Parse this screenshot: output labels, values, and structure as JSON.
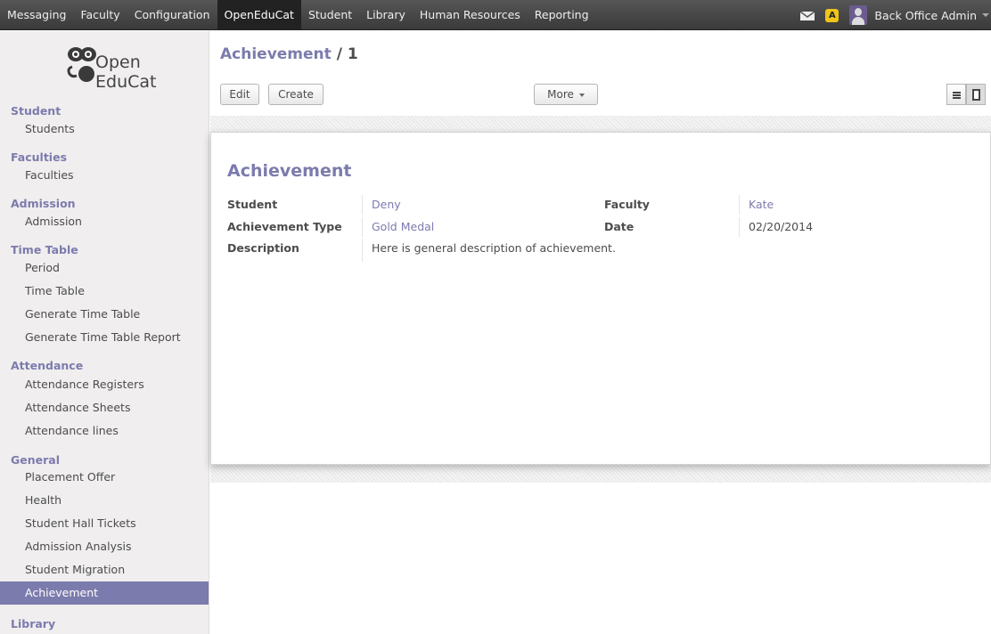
{
  "topbar": {
    "menu": [
      "Messaging",
      "Faculty",
      "Configuration",
      "OpenEduCat",
      "Student",
      "Library",
      "Human Resources",
      "Reporting"
    ],
    "active_menu": "OpenEduCat",
    "user_name": "Back Office Admin",
    "warning_label": "A",
    "colors": {
      "bar": "#3a3a3a",
      "active": "#222222"
    }
  },
  "sidebar": {
    "logo": {
      "line1": "Open",
      "line2": "EduCat"
    },
    "sections": [
      {
        "title": "Student",
        "items": [
          "Students"
        ]
      },
      {
        "title": "Faculties",
        "items": [
          "Faculties"
        ]
      },
      {
        "title": "Admission",
        "items": [
          "Admission"
        ]
      },
      {
        "title": "Time Table",
        "items": [
          "Period",
          "Time Table",
          "Generate Time Table",
          "Generate Time Table Report"
        ]
      },
      {
        "title": "Attendance",
        "items": [
          "Attendance Registers",
          "Attendance Sheets",
          "Attendance lines"
        ]
      },
      {
        "title": "General",
        "items": [
          "Placement Offer",
          "Health",
          "Student Hall Tickets",
          "Admission Analysis",
          "Student Migration",
          "Achievement"
        ]
      },
      {
        "title": "Library",
        "items": []
      }
    ],
    "active_item": "Achievement",
    "accent_color": "#7c7bad"
  },
  "breadcrumb": {
    "parent": "Achievement",
    "separator": " / ",
    "current": "1"
  },
  "toolbar": {
    "edit_label": "Edit",
    "create_label": "Create",
    "more_label": "More"
  },
  "form": {
    "title": "Achievement",
    "fields": {
      "student_label": "Student",
      "student_value": "Deny",
      "faculty_label": "Faculty",
      "faculty_value": "Kate",
      "type_label": "Achievement Type",
      "type_value": "Gold Medal",
      "date_label": "Date",
      "date_value": "02/20/2014",
      "description_label": "Description",
      "description_value": "Here is general description of achievement."
    }
  }
}
